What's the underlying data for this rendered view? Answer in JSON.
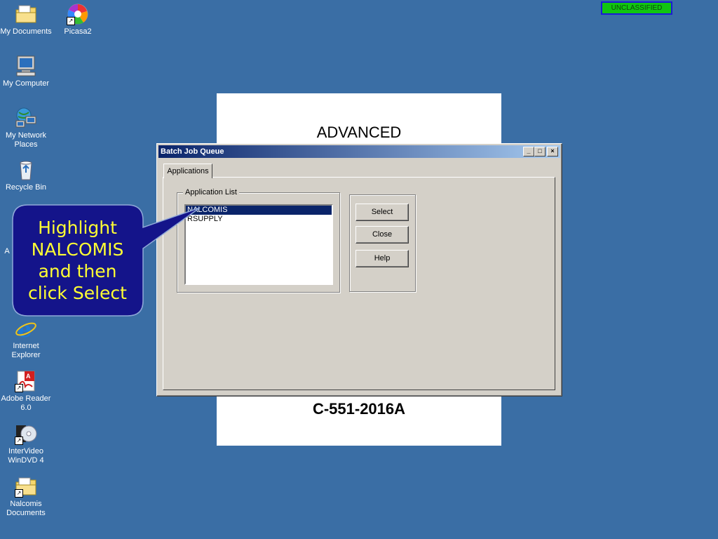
{
  "desktop": {
    "icons": [
      {
        "label": "My Documents",
        "icon": "folder-documents-icon"
      },
      {
        "label": "Picasa2",
        "icon": "picasa-icon"
      },
      {
        "label": "My Computer",
        "icon": "computer-icon"
      },
      {
        "label": "My Network Places",
        "icon": "network-icon"
      },
      {
        "label": "Recycle Bin",
        "icon": "recycle-bin-icon"
      },
      {
        "label": "A",
        "icon": "partial-icon"
      },
      {
        "label": "Internet Explorer",
        "icon": "ie-icon"
      },
      {
        "label": "Adobe Reader 6.0",
        "icon": "adobe-reader-icon"
      },
      {
        "label": "InterVideo WinDVD 4",
        "icon": "windvd-icon"
      },
      {
        "label": "Nalcomis Documents",
        "icon": "folder-icon"
      }
    ],
    "banner": "UNCLASSIFIED"
  },
  "slide": {
    "title": "ADVANCED",
    "code": "C-551-2016A"
  },
  "window": {
    "title": "Batch Job Queue",
    "controls": {
      "minimize": "_",
      "maximize": "□",
      "close": "×"
    },
    "tabs": [
      {
        "label": "Applications"
      }
    ],
    "group_label": "Application List",
    "list_items": [
      {
        "label": "NALCOMIS",
        "selected": true
      },
      {
        "label": "RSUPPLY",
        "selected": false
      }
    ],
    "buttons": {
      "select": "Select",
      "close": "Close",
      "help": "Help"
    }
  },
  "callout": {
    "text": "Highlight NALCOMIS and then click Select"
  },
  "colors": {
    "desktop": "#3a6ea5",
    "titlebar_start": "#0a246a",
    "selection": "#0a246a",
    "callout_fill": "#14148a",
    "callout_text": "#ffff33",
    "banner": "#11c511"
  }
}
